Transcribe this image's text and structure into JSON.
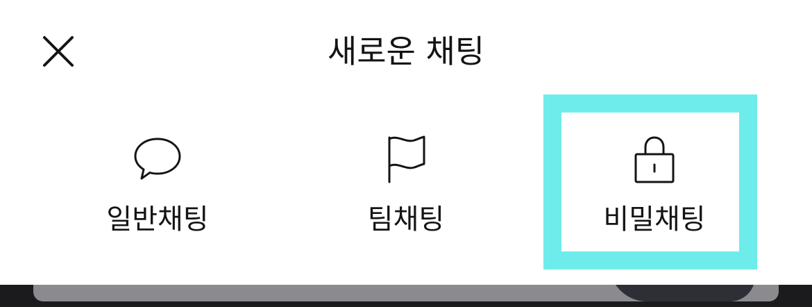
{
  "header": {
    "title": "새로운 채팅",
    "close_icon": "close-icon"
  },
  "options": [
    {
      "label": "일반채팅",
      "icon": "speech-bubble-icon"
    },
    {
      "label": "팀채팅",
      "icon": "flag-icon"
    },
    {
      "label": "비밀채팅",
      "icon": "lock-icon"
    }
  ],
  "colors": {
    "highlight": "#6eecec",
    "text": "#141414",
    "sheet_background": "#ffffff"
  }
}
